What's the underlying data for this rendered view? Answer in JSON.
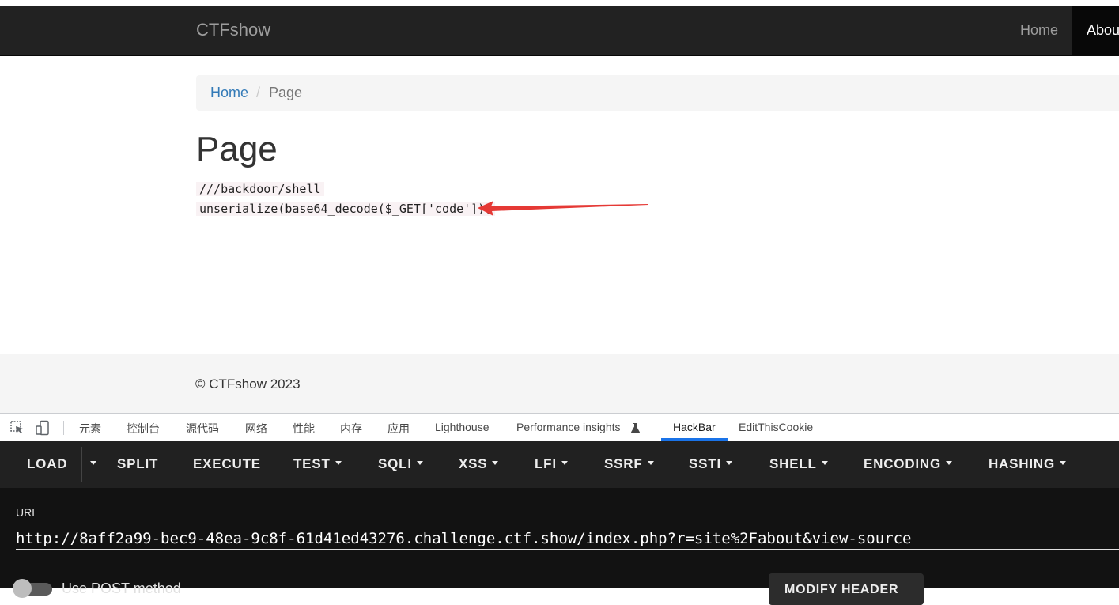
{
  "navbar": {
    "brand": "CTFshow",
    "items": [
      {
        "label": "Home"
      },
      {
        "label": "About"
      }
    ]
  },
  "breadcrumb": {
    "home": "Home",
    "separator": "/",
    "current": "Page"
  },
  "page": {
    "title": "Page",
    "code_lines": [
      "///backdoor/shell",
      "unserialize(base64_decode($_GET['code']))"
    ]
  },
  "footer": {
    "text": "© CTFshow 2023"
  },
  "devtools": {
    "tabs": [
      {
        "label": "元素"
      },
      {
        "label": "控制台"
      },
      {
        "label": "源代码"
      },
      {
        "label": "网络"
      },
      {
        "label": "性能"
      },
      {
        "label": "内存"
      },
      {
        "label": "应用"
      },
      {
        "label": "Lighthouse"
      },
      {
        "label": "Performance insights"
      },
      {
        "label": "HackBar"
      },
      {
        "label": "EditThisCookie"
      }
    ],
    "active_tab": "HackBar",
    "accent_color": "#1a73e8"
  },
  "hackbar": {
    "toolbar": {
      "load": "LOAD",
      "split": "SPLIT",
      "execute": "EXECUTE",
      "test": "TEST",
      "sqli": "SQLI",
      "xss": "XSS",
      "lfi": "LFI",
      "ssrf": "SSRF",
      "ssti": "SSTI",
      "shell": "SHELL",
      "encoding": "ENCODING",
      "hashing": "HASHING"
    },
    "url_label": "URL",
    "url_value": "http://8aff2a99-bec9-48ea-9c8f-61d41ed43276.challenge.ctf.show/index.php?r=site%2Fabout&view-source",
    "post_label": "Use POST method",
    "modify_header": "MODIFY HEADER"
  },
  "colors": {
    "navbar_bg": "#222222",
    "link": "#337ab7",
    "arrow": "#e53935",
    "hackbar_bg": "#212121"
  }
}
